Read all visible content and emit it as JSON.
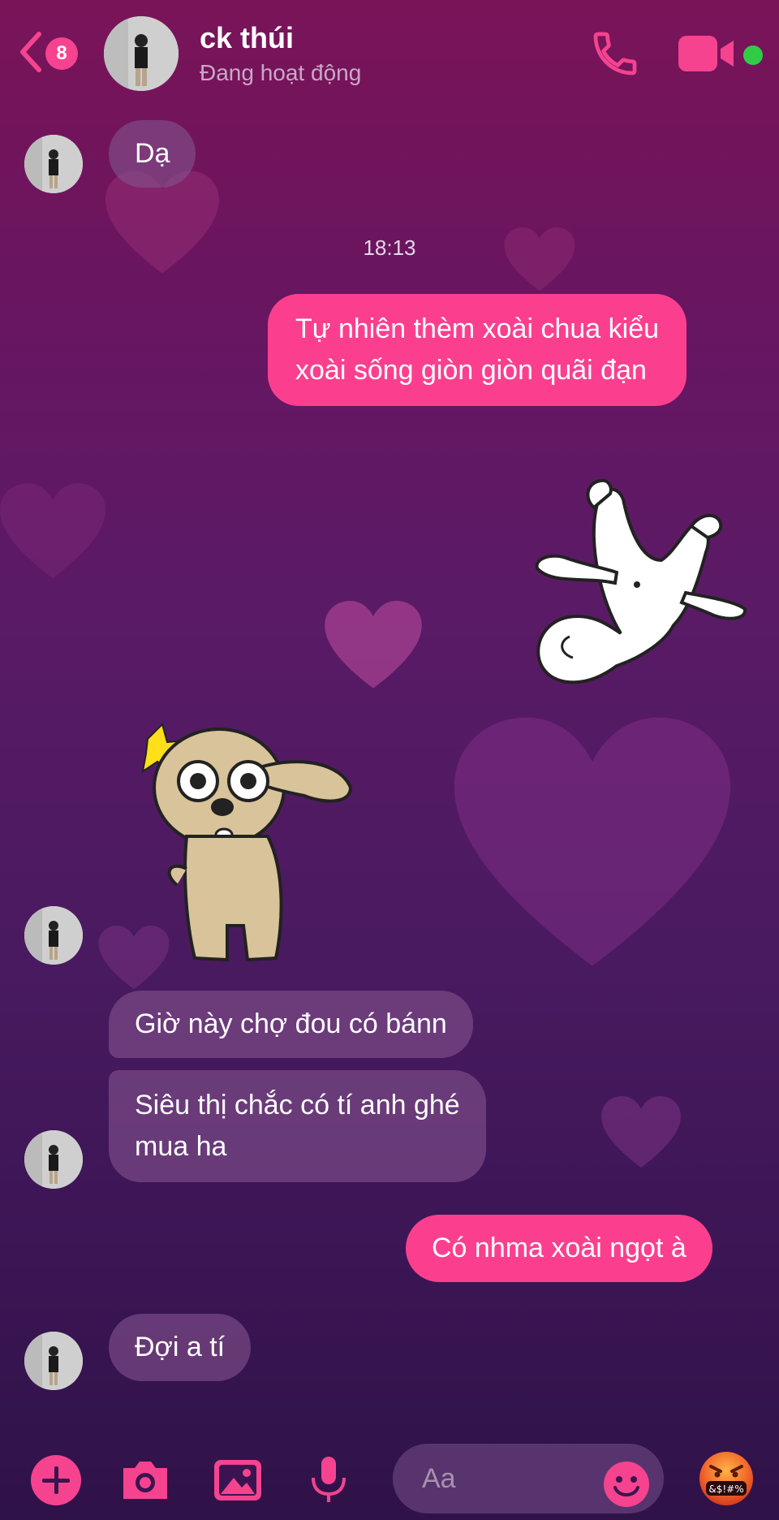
{
  "header": {
    "unread_count": "8",
    "contact_name": "ck thúi",
    "status": "Đang hoạt động",
    "icons": {
      "back": "chevron-left-icon",
      "call": "phone-icon",
      "video": "video-camera-icon",
      "online": "online-status-dot"
    }
  },
  "messages": {
    "m1": "Dạ",
    "timestamp": "18:13",
    "m2_line1": "Tự nhiên thèm xoài chua kiểu",
    "m2_line2": "xoài sống giòn giòn quãi đạn",
    "m3": "Giờ này chợ đou có bánn",
    "m4_line1": "Siêu thị chắc có tí anh ghé",
    "m4_line2": "mua ha",
    "m5": "Có nhma xoài ngọt à",
    "m6": "Đợi a tí"
  },
  "stickers": {
    "out_sticker": "white-cat-sticker",
    "in_sticker": "surprised-dog-sticker"
  },
  "bottom_bar": {
    "placeholder": "Aa",
    "angry_label": "&$!#%",
    "icons": {
      "add": "plus-icon",
      "camera": "camera-icon",
      "gallery": "image-icon",
      "mic": "microphone-icon",
      "emoji": "smile-icon",
      "reaction": "angry-face-icon"
    }
  },
  "colors": {
    "accent": "#fb3f8e",
    "incoming_bubble": "#82508c",
    "online": "#31cc46"
  }
}
